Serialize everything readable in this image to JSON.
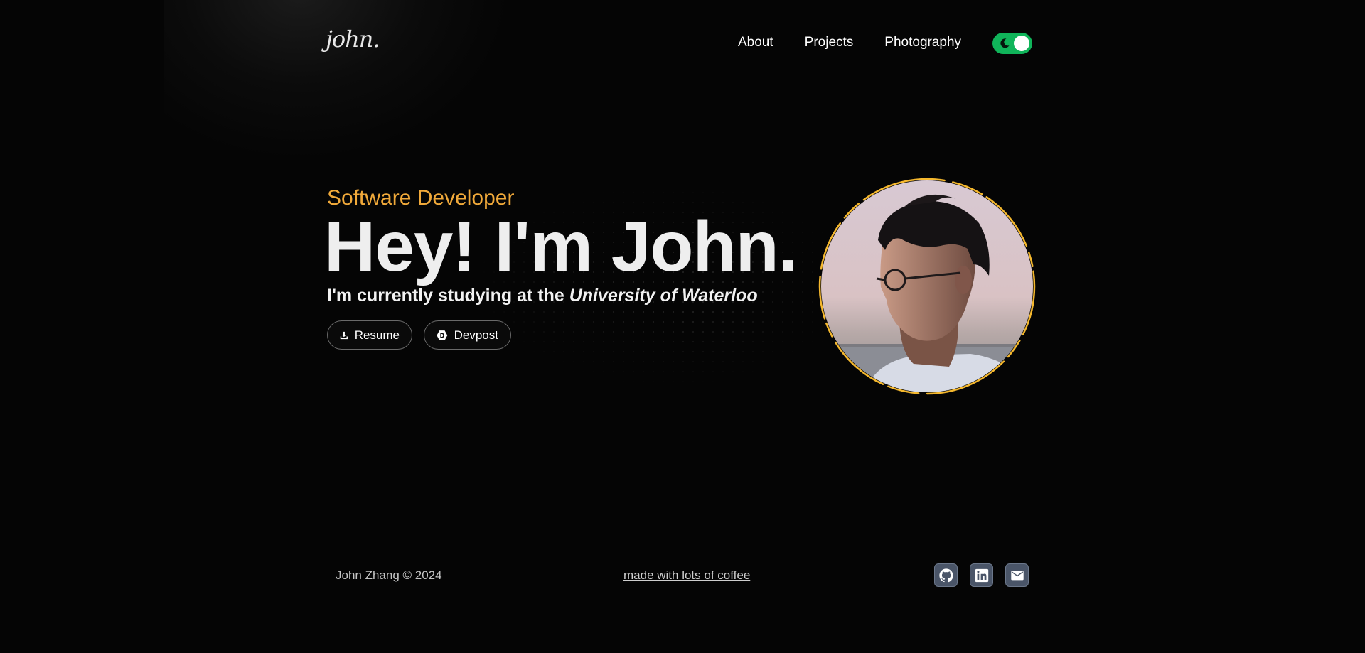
{
  "header": {
    "logo": "john.",
    "nav": [
      {
        "label": "About"
      },
      {
        "label": "Projects"
      },
      {
        "label": "Photography"
      }
    ],
    "theme_toggle": {
      "state": "dark",
      "icon": "moon-icon",
      "color": "#10b45a"
    }
  },
  "hero": {
    "role": "Software Developer",
    "headline": "Hey! I'm John.",
    "study_prefix": "I'm currently studying at the ",
    "university": "University of Waterloo",
    "buttons": [
      {
        "label": "Resume",
        "icon": "download-icon"
      },
      {
        "label": "Devpost",
        "icon": "devpost-icon"
      }
    ],
    "accent_color": "#f0a93a",
    "ring_color": "#f5b82e"
  },
  "footer": {
    "copyright": "John Zhang © 2024",
    "tagline": "made with lots of coffee",
    "social": [
      {
        "icon": "github-icon"
      },
      {
        "icon": "linkedin-icon"
      },
      {
        "icon": "mail-icon"
      }
    ]
  }
}
